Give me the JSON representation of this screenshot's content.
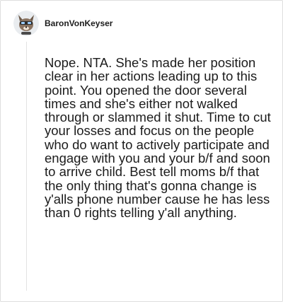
{
  "comment": {
    "author": {
      "username": "BaronVonKeyser",
      "avatar_icon": "snoo-avatar-icon"
    },
    "body": "Nope. NTA. She's made her position clear in her actions leading up to this point. You opened the door several times and she's either not walked through or slammed it shut. Time to cut your losses and focus on the people who do want to actively participate and engage with you and your b/f and soon to arrive child. Best tell moms b/f that the only thing that's gonna change is y'alls phone number cause he has less than 0 rights telling y'all anything."
  },
  "colors": {
    "text": "#1c1c1c",
    "border": "#dedede",
    "thread_line": "#e2e2e2",
    "background": "#ffffff"
  }
}
